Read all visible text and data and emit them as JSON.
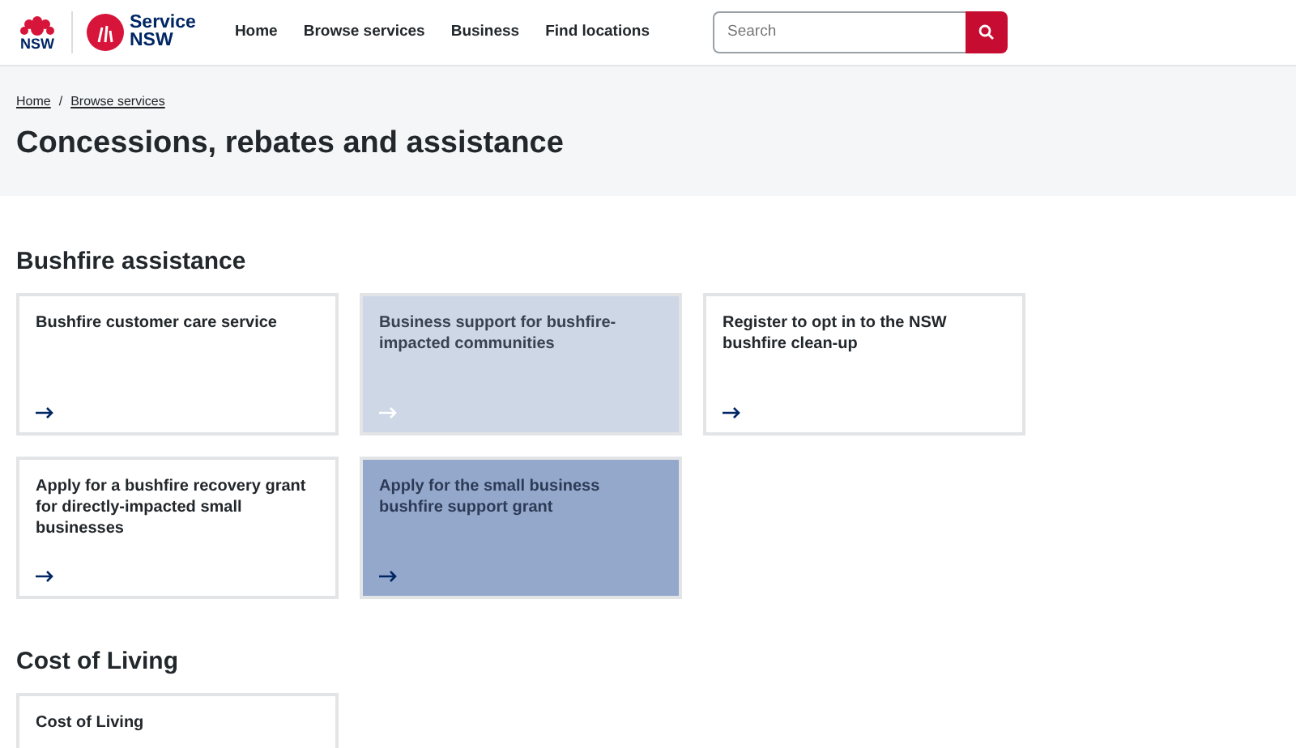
{
  "header": {
    "logo_text": "NSW",
    "brand": [
      "Service",
      "NSW"
    ],
    "nav": [
      "Home",
      "Browse services",
      "Business",
      "Find locations"
    ],
    "search": {
      "placeholder": "Search"
    }
  },
  "breadcrumb": {
    "links": [
      "Home",
      "Browse services"
    ],
    "separator": "/"
  },
  "title": "Concessions, rebates and assistance",
  "sections": [
    {
      "heading": "Bushfire assistance",
      "cards": [
        {
          "title": "Bushfire customer care service",
          "hovered": false,
          "pressed": false
        },
        {
          "title": "Business support for bushfire-impacted communities",
          "hovered": true,
          "pressed": false
        },
        {
          "title": "Register to opt in to the NSW bushfire clean-up",
          "hovered": false,
          "pressed": false
        },
        {
          "title": "Apply for a bushfire recovery grant for directly-impacted small businesses",
          "hovered": false,
          "pressed": false
        },
        {
          "title": "Apply for the small business bushfire support grant",
          "hovered": false,
          "pressed": true
        }
      ]
    },
    {
      "heading": "Cost of Living",
      "cards": [
        {
          "title": "Cost of Living",
          "hovered": false,
          "pressed": false
        }
      ]
    }
  ]
}
